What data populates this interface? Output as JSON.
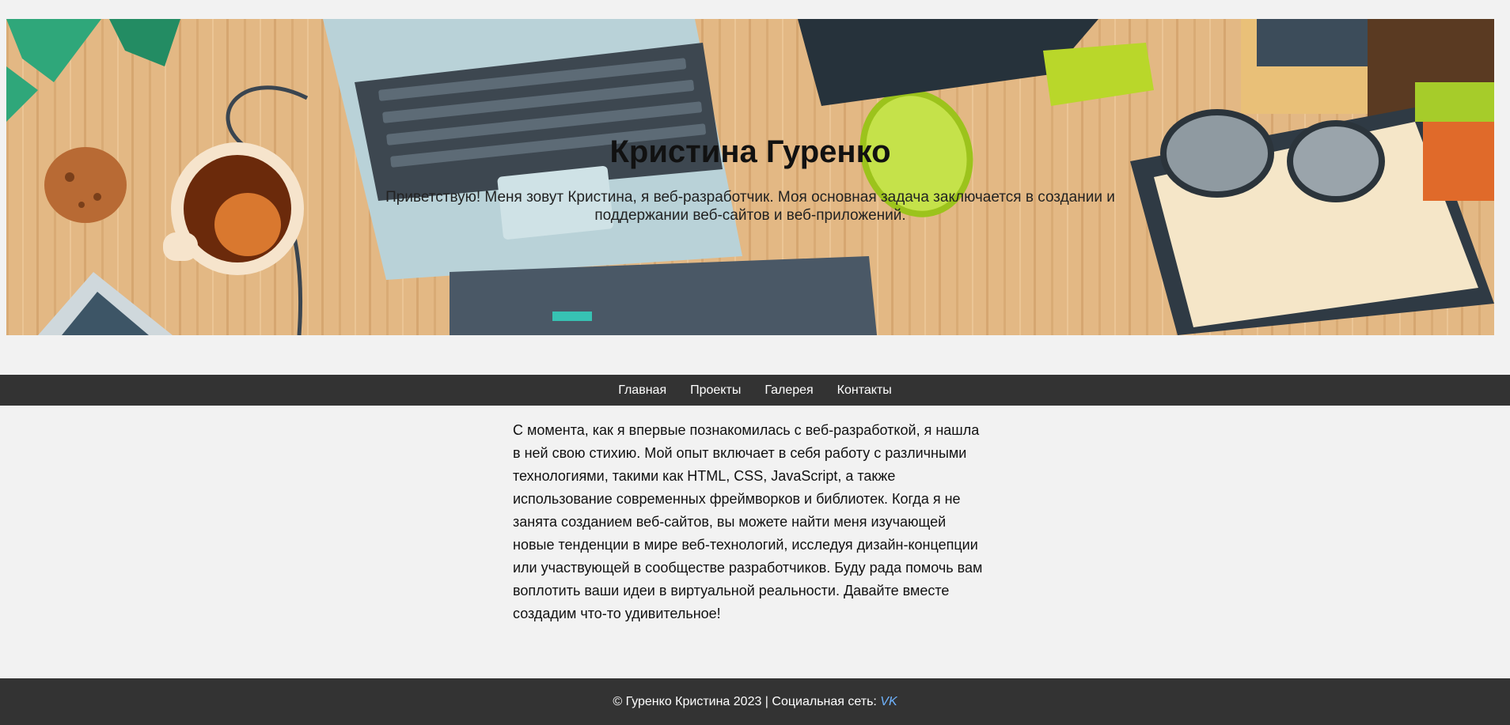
{
  "hero": {
    "title": "Кристина Гуренко",
    "subtitle": "Приветствую! Меня зовут Кристина, я веб-разработчик. Моя основная задача заключается в создании и поддержании веб-сайтов и веб-приложений."
  },
  "nav": {
    "items": [
      {
        "label": "Главная"
      },
      {
        "label": "Проекты"
      },
      {
        "label": "Галерея"
      },
      {
        "label": "Контакты"
      }
    ]
  },
  "main": {
    "text": "С момента, как я впервые познакомилась с веб-разработкой, я нашла в ней свою стихию. Мой опыт включает в себя работу с различными технологиями, такими как HTML, CSS, JavaScript, а также использование современных фреймворков и библиотек. Когда я не занята созданием веб-сайтов, вы можете найти меня изучающей новые тенденции в мире веб-технологий, исследуя дизайн-концепции или участвующей в сообществе разработчиков. Буду рада помочь вам воплотить ваши идеи в виртуальной реальности. Давайте вместе создадим что-то удивительное!"
  },
  "footer": {
    "copyright": "© Гуренко Кристина 2023 | Социальная сеть: ",
    "social_link": "VK"
  },
  "colors": {
    "page_bg": "#f2f2f2",
    "bar_bg": "#333333",
    "link": "#6fb3ff"
  }
}
